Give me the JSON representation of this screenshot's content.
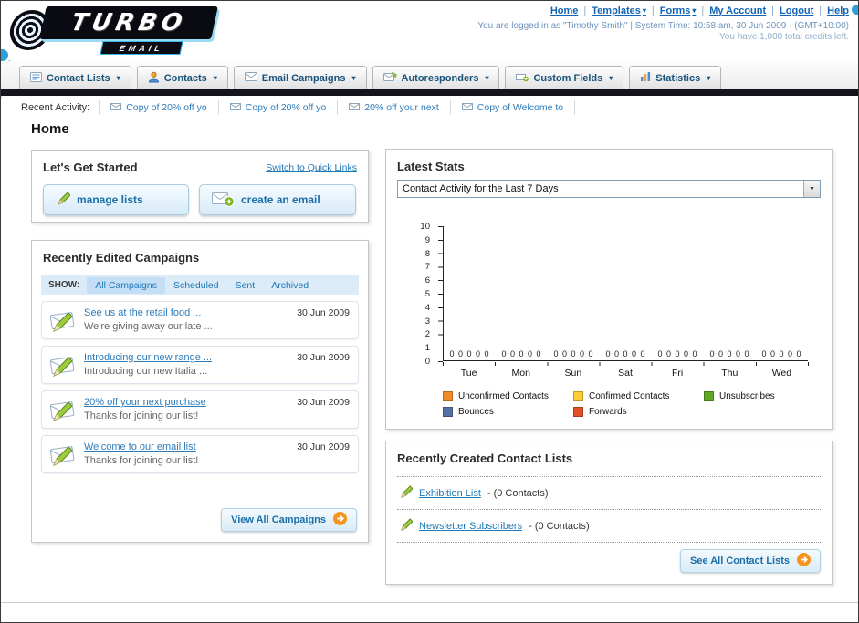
{
  "theme": {
    "link_blue": "#1e7ab8",
    "nav_text": "#17527a",
    "dark_bar": "#14141e",
    "button_orange": "#f7941d"
  },
  "header": {
    "logo_text": "TURBO",
    "logo_subtext": "EMAIL",
    "top_links": [
      "Home",
      "Templates",
      "Forms",
      "My Account",
      "Logout",
      "Help"
    ],
    "login_info": "You are logged in as \"Timothy Smith\" | System Time: 10:58 am, 30 Jun 2009 - (GMT+10:00)",
    "credits_info": "You have 1,000 total credits left."
  },
  "nav": {
    "items": [
      {
        "label": "Contact Lists",
        "icon": "contact-lists-icon"
      },
      {
        "label": "Contacts",
        "icon": "contacts-icon"
      },
      {
        "label": "Email Campaigns",
        "icon": "envelope-icon"
      },
      {
        "label": "Autoresponders",
        "icon": "autoresponder-icon"
      },
      {
        "label": "Custom Fields",
        "icon": "custom-fields-icon"
      },
      {
        "label": "Statistics",
        "icon": "bar-chart-icon"
      }
    ]
  },
  "recent_activity": {
    "label": "Recent Activity:",
    "items": [
      "Copy of 20% off yo",
      "Copy of 20% off yo",
      "20% off your next",
      "Copy of Welcome to"
    ]
  },
  "page_title": "Home",
  "get_started": {
    "title": "Let's Get Started",
    "switch_link": "Switch to Quick Links",
    "manage_lists_label": "manage lists",
    "create_email_label": "create an email"
  },
  "campaigns": {
    "title": "Recently Edited Campaigns",
    "show_label": "SHOW:",
    "filters": [
      "All Campaigns",
      "Scheduled",
      "Sent",
      "Archived"
    ],
    "active_filter": "All Campaigns",
    "items": [
      {
        "title": "See us at the retail food ...",
        "subtitle": "We're giving away our late ...",
        "date": "30 Jun 2009"
      },
      {
        "title": "Introducing our new range ...",
        "subtitle": "Introducing our new Italia ...",
        "date": "30 Jun 2009"
      },
      {
        "title": "20% off your next purchase",
        "subtitle": "Thanks for joining our list!",
        "date": "30 Jun 2009"
      },
      {
        "title": "Welcome to our email list",
        "subtitle": "Thanks for joining our list!",
        "date": "30 Jun 2009"
      }
    ],
    "view_all_label": "View All Campaigns"
  },
  "stats": {
    "title": "Latest Stats",
    "range_selector_value": "Contact Activity for the Last 7 Days",
    "chart_data": {
      "type": "bar",
      "title": "Contact Activity for the Last 7 Days",
      "categories": [
        "Tue",
        "Mon",
        "Sun",
        "Sat",
        "Fri",
        "Thu",
        "Wed"
      ],
      "series": [
        {
          "name": "Unconfirmed Contacts",
          "color": "#f28c28",
          "values": [
            0,
            0,
            0,
            0,
            0,
            0,
            0
          ]
        },
        {
          "name": "Confirmed Contacts",
          "color": "#ffcc33",
          "values": [
            0,
            0,
            0,
            0,
            0,
            0,
            0
          ]
        },
        {
          "name": "Unsubscribes",
          "color": "#61a624",
          "values": [
            0,
            0,
            0,
            0,
            0,
            0,
            0
          ]
        },
        {
          "name": "Bounces",
          "color": "#5470a0",
          "values": [
            0,
            0,
            0,
            0,
            0,
            0,
            0
          ]
        },
        {
          "name": "Forwards",
          "color": "#e0502a",
          "values": [
            0,
            0,
            0,
            0,
            0,
            0,
            0
          ]
        }
      ],
      "ylim": [
        0,
        10
      ],
      "yticks": [
        0,
        1,
        2,
        3,
        4,
        5,
        6,
        7,
        8,
        9,
        10
      ],
      "legend_position": "bottom",
      "grid": false
    }
  },
  "contact_lists": {
    "title": "Recently Created Contact Lists",
    "items": [
      {
        "name": "Exhibition List",
        "detail": "- (0 Contacts)"
      },
      {
        "name": "Newsletter Subscribers",
        "detail": "- (0 Contacts)"
      }
    ],
    "see_all_label": "See All Contact Lists"
  }
}
